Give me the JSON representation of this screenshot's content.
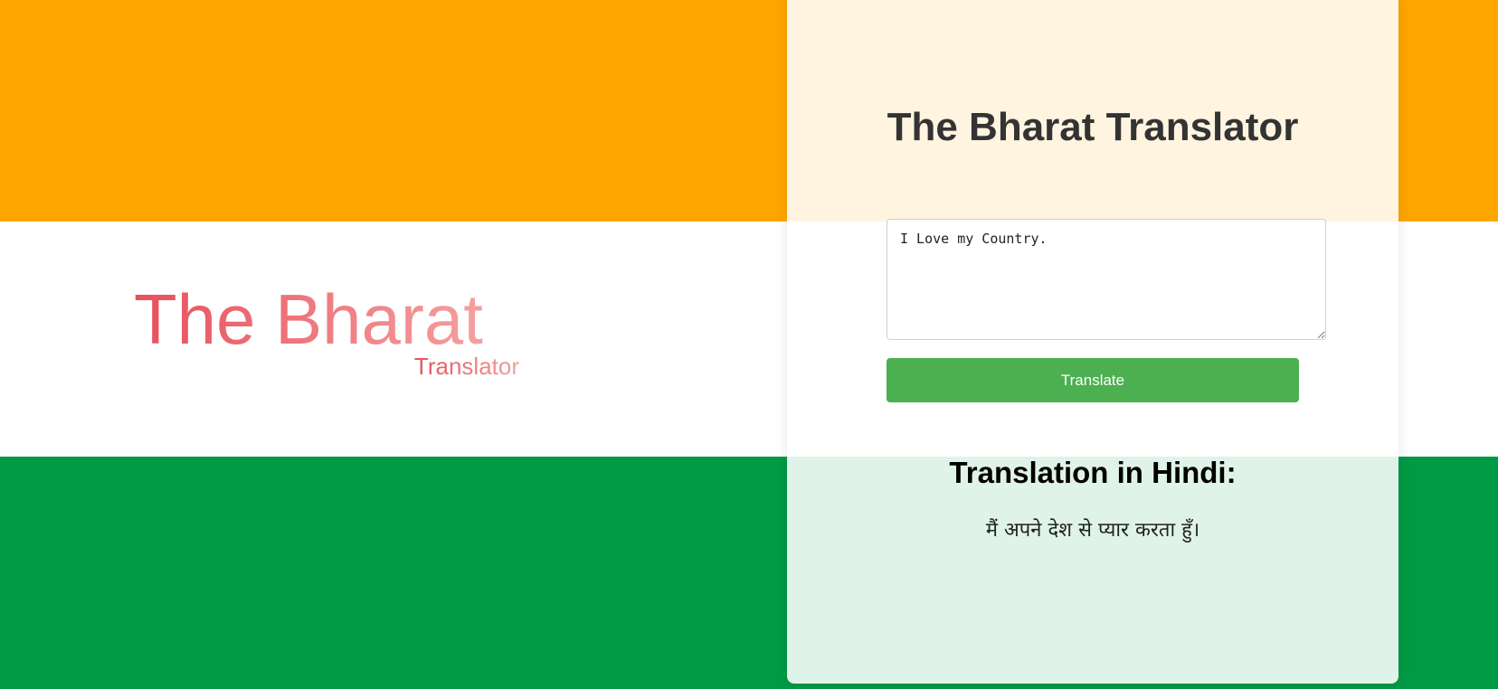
{
  "colors": {
    "saffron": "#FFA500",
    "white": "#FFFFFF",
    "green": "#009A44",
    "button": "#4CAF50",
    "logo_gradient_start": "#E8505B",
    "logo_gradient_end": "#F4A0A0"
  },
  "logo": {
    "main_text": "The Bharat",
    "sub_text": "Translator"
  },
  "card": {
    "title": "The Bharat Translator",
    "input": {
      "value": "I Love my Country.",
      "placeholder": ""
    },
    "translate_button_label": "Translate",
    "result_heading": "Translation in Hindi:",
    "result_text": "मैं अपने देश से प्यार करता हुँ।"
  }
}
